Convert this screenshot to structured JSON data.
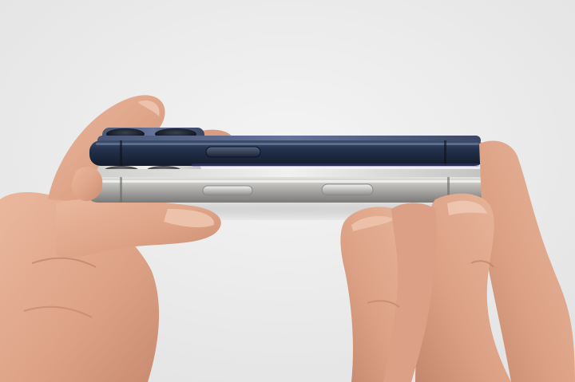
{
  "photo": {
    "subject": "two-phones-side-by-side",
    "background_color": "#ececec",
    "phones": [
      {
        "position": "top",
        "finish_color": "#1f2c44",
        "buttons": 1
      },
      {
        "position": "bottom",
        "finish_color": "#a9a9a7",
        "buttons": 2
      }
    ],
    "skin_tone": "#e3ad93"
  }
}
